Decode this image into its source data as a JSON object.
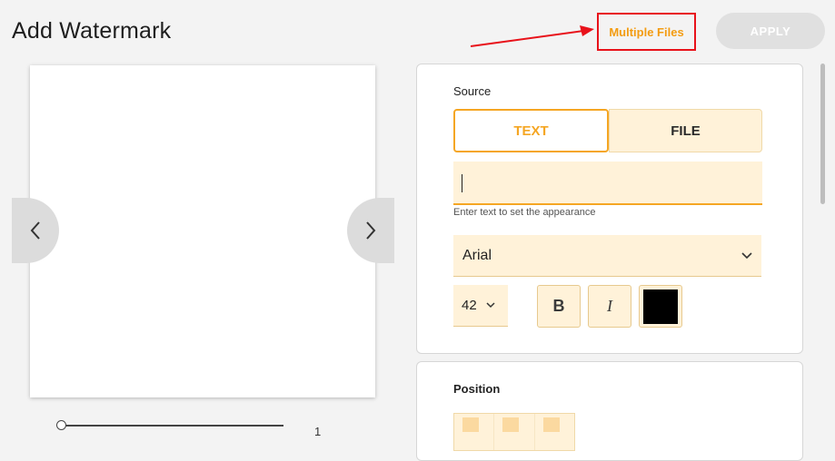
{
  "header": {
    "title": "Add Watermark",
    "multiple_files_label": "Multiple Files",
    "apply_label": "APPLY"
  },
  "preview": {
    "page_number": "1",
    "zoom_level": 0
  },
  "source": {
    "label": "Source",
    "tabs": [
      {
        "label": "TEXT",
        "selected": true
      },
      {
        "label": "FILE",
        "selected": false
      }
    ],
    "text_value": "",
    "hint": "Enter text to set the appearance",
    "font": "Arial",
    "font_size": "42",
    "bold_label": "B",
    "italic_label": "I",
    "color": "#000000"
  },
  "position": {
    "label": "Position"
  },
  "colors": {
    "accent": "#f5a623",
    "annotation": "#e8121a",
    "field_bg": "#fff2d9"
  }
}
